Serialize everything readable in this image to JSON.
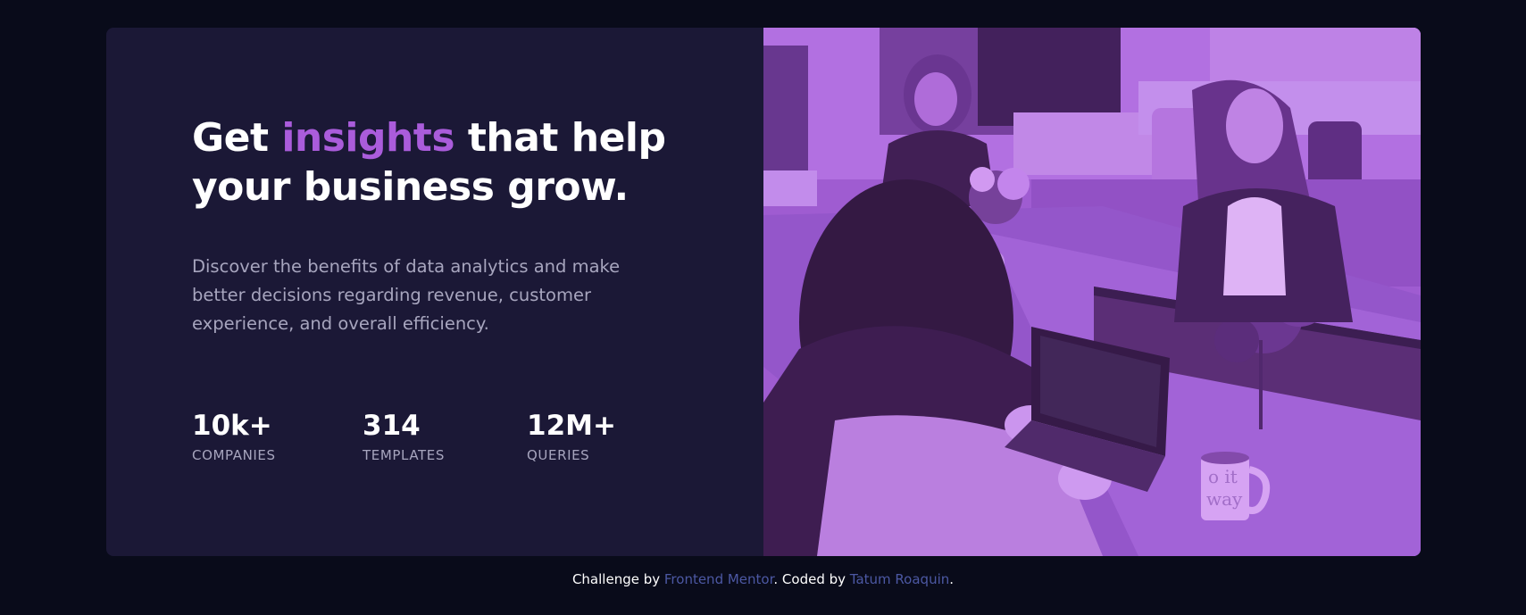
{
  "hero": {
    "headline_before": "Get ",
    "headline_accent": "insights",
    "headline_after": " that help your business grow.",
    "description": "Discover the benefits of data analytics and make better decisions regarding revenue, customer experience, and overall efficiency."
  },
  "stats": [
    {
      "value": "10k+",
      "label": "COMPANIES"
    },
    {
      "value": "314",
      "label": "TEMPLATES"
    },
    {
      "value": "12M+",
      "label": "QUERIES"
    }
  ],
  "image": {
    "overlay_color": "#aa5cdb",
    "mug_text_line1": "o it",
    "mug_text_line2": "way"
  },
  "attribution": {
    "prefix": "Challenge by ",
    "link1": "Frontend Mentor",
    "middle": ". Coded by ",
    "link2": "Tatum Roaquin",
    "suffix": "."
  },
  "colors": {
    "background": "#090b1a",
    "card": "#1b1836",
    "accent": "#aa5cdb",
    "link": "#4c58a3"
  }
}
